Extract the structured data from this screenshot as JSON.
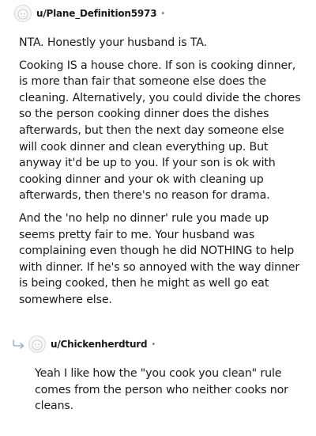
{
  "comment": {
    "username": "u/Plane_Definition5973",
    "separator": "•",
    "avatar_icon": "snoo-avatar-icon",
    "paragraphs": [
      "NTA. Honestly your husband is TA.",
      "Cooking IS a house chore. If son is cooking dinner, is more than fair that someone else does the cleaning. Alternatively, you could divide the chores so the person cooking dinner does the dishes afterwards, but then the next day someone else will cook dinner and clean everything up. But anyway it'd be up to you. If your son is ok with cooking dinner and your ok with cleaning up afterwards, then there's no reason for drama.",
      "And the 'no help no dinner' rule you made up seems pretty fair to me. Your husband was complaining even though he did NOTHING to help with dinner. If he's so annoyed with the way dinner is being cooked, then he might as well go eat somewhere else."
    ]
  },
  "reply": {
    "username": "u/Chickenherdturd",
    "separator": "•",
    "reply_icon": "reply-arrow-icon",
    "avatar_icon": "snoo-avatar-icon",
    "text": "Yeah I like how the \"you cook you clean\" rule comes from the person who neither cooks nor cleans."
  },
  "colors": {
    "text": "#1a1a1b",
    "meta": "#7c7c7c",
    "reply_arrow": "#9fb5c8",
    "avatar_border": "#d7d7d7"
  }
}
